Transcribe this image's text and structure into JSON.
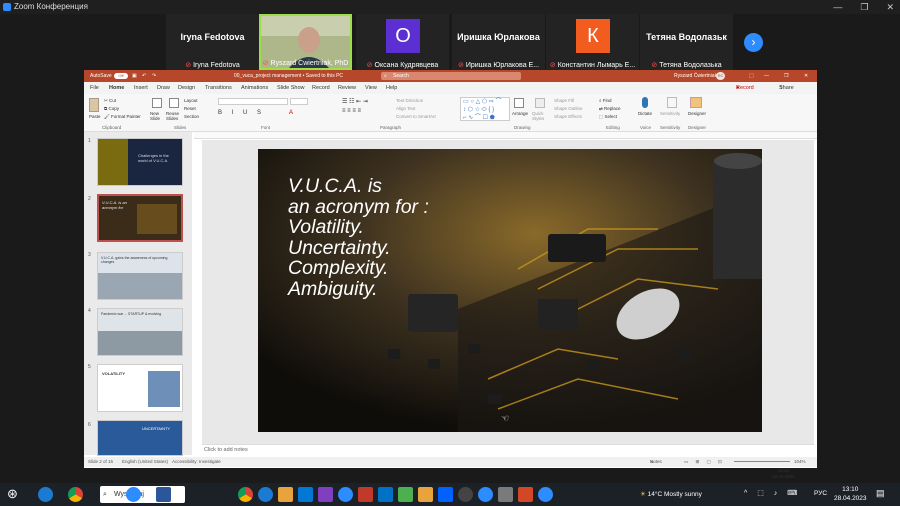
{
  "zoom": {
    "title": "Zoom Конференция",
    "participants": [
      {
        "big": "Iryna Fedotova",
        "name": "Iryna Fedotova"
      },
      {
        "name": "Ryszard Ćwiertniak, PhD"
      },
      {
        "avatar": "О",
        "avatar_color": "#5b2fd1",
        "name": "Оксана Кудрявцева"
      },
      {
        "big": "Иришка Юрлаковa",
        "name": "Иришка Юрлакова Е..."
      },
      {
        "avatar": "К",
        "avatar_color": "#f25c1e",
        "name": "Константин Лымарь Е..."
      },
      {
        "big": "Тетяна Водолазьк",
        "name": "Тетяна Водолазька"
      }
    ]
  },
  "ppt": {
    "autosave": "AutoSave",
    "autosave_state": "Off",
    "file_title": "00_vuca_project management • Saved to this PC",
    "search": "Search",
    "user": "Ryszard Ćwiertniak",
    "user_initials": "RĆ",
    "tabs": [
      "File",
      "Home",
      "Insert",
      "Draw",
      "Design",
      "Transitions",
      "Animations",
      "Slide Show",
      "Record",
      "Review",
      "View",
      "Help"
    ],
    "record_btn": "Record",
    "share_btn": "Share",
    "groups": [
      "Clipboard",
      "Slides",
      "Font",
      "Paragraph",
      "Drawing",
      "Editing",
      "Voice",
      "Sensitivity",
      "Designer"
    ],
    "clipboard": {
      "paste": "Paste",
      "cut": "Cut",
      "copy": "Copy",
      "format_painter": "Format Painter"
    },
    "slides_grp": {
      "new_slide": "New Slide",
      "reuse": "Reuse Slides",
      "layout": "Layout",
      "reset": "Reset",
      "section": "Section"
    },
    "para": {
      "text_direction": "Text Direction",
      "align_text": "Align Text",
      "smartart": "Convert to SmartArt"
    },
    "drawing": {
      "arrange": "Arrange",
      "quick_styles": "Quick Styles",
      "shape_fill": "Shape Fill",
      "shape_outline": "Shape Outline",
      "shape_effects": "Shape Effects"
    },
    "editing": {
      "find": "Find",
      "replace": "Replace",
      "select": "Select"
    },
    "voice": {
      "dictate": "Dictate"
    },
    "sensitivity": "Sensitivity",
    "designer": "Designer",
    "thumbs": [
      {
        "n": "1",
        "text": "Challenges in the world of V.U.C.A."
      },
      {
        "n": "2",
        "text": "V.U.C.A. is an acronym for"
      },
      {
        "n": "3",
        "text": "V.U.C.A. gains the awareness of upcoming changes"
      },
      {
        "n": "4",
        "text": "Pandemic war ... STARTUP & evolving"
      },
      {
        "n": "5",
        "text": "VOLATILITY"
      },
      {
        "n": "6",
        "text": "UNCERTAINTY"
      }
    ],
    "slide_lines": [
      "V.U.C.A. is",
      "an acronym for :",
      "Volatility.",
      "Uncertainty.",
      "Complexity.",
      "Ambiguity."
    ],
    "notes_placeholder": "Click to add notes",
    "status_slide": "Slide 2 of 15",
    "status_lang": "English (United States)",
    "status_access": "Accessibility: Investigate",
    "status_notes": "Notes",
    "status_zoom": "104%"
  },
  "taskbar": {
    "search": "Wyszukaj",
    "weather": "14°C  Mostly sunny",
    "lang": "РУС",
    "time": "13:10",
    "date": "28.04.2023",
    "mini_time": "12:10",
    "mini_date": "28.04.2023"
  }
}
